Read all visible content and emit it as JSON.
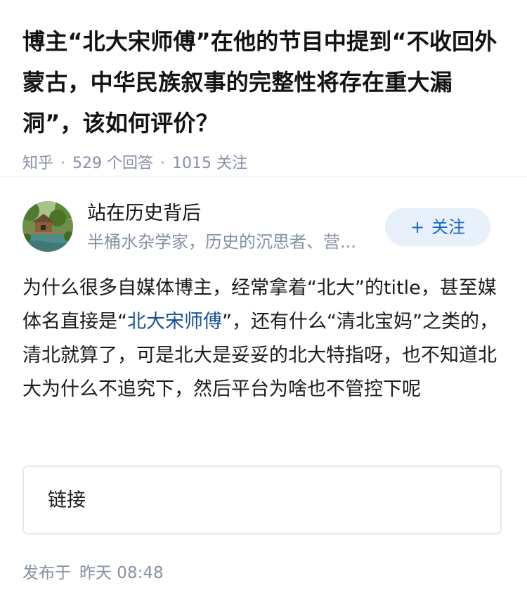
{
  "question": {
    "title": "博主“北大宋师傅”在他的节目中提到“不收回外蒙古，中华民族叙事的完整性将存在重大漏洞”，该如何评价？",
    "source": "知乎",
    "answer_count": "529 个回答",
    "follower_count": "1015 关注",
    "separator": "·"
  },
  "author": {
    "name": "站在历史背后",
    "bio": "半桶水杂学家，历史的沉思者、营...",
    "follow_label": "关注",
    "follow_icon": "plus-icon",
    "avatar_icon": "landscape-avatar"
  },
  "answer": {
    "text_1": "为什么很多自媒体博主，经常拿着“北大”的title，甚至媒体名直接是“",
    "link_text": "北大宋师傅",
    "text_2": "”，还有什么“清北宝妈”之类的，清北就算了，可是北大是妥妥的北大特指呀，也不知道北大为什么不追究下，然后平台为啥也不管控下呢"
  },
  "link_card": {
    "label": "链接"
  },
  "publish": {
    "prefix": "发布于",
    "time": "昨天 08:48"
  },
  "colors": {
    "link": "#175199",
    "meta": "#8590a6",
    "follow_bg": "#e7f0fb",
    "follow_text": "#1768c9"
  }
}
